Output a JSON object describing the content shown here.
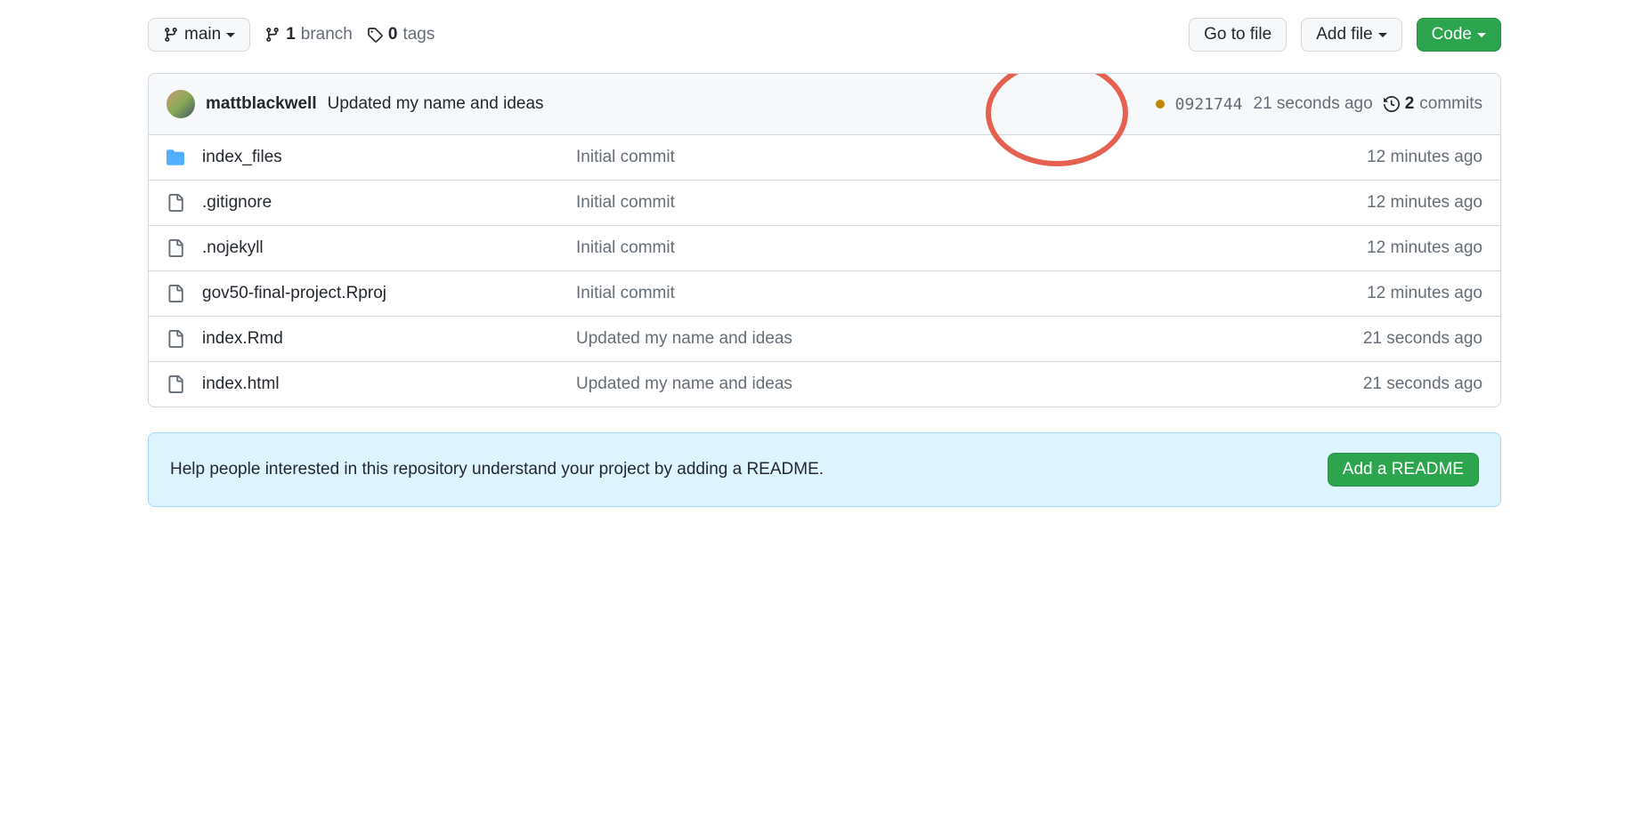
{
  "toolbar": {
    "branch_name": "main",
    "branch_count": "1",
    "branch_label": "branch",
    "tag_count": "0",
    "tag_label": "tags",
    "go_to_file": "Go to file",
    "add_file": "Add file",
    "code": "Code"
  },
  "latest_commit": {
    "author": "mattblackwell",
    "message": "Updated my name and ideas",
    "sha": "0921744",
    "time": "21 seconds ago",
    "commit_count": "2",
    "commit_label": "commits"
  },
  "files": [
    {
      "type": "dir",
      "name": "index_files",
      "message": "Initial commit",
      "time": "12 minutes ago"
    },
    {
      "type": "file",
      "name": ".gitignore",
      "message": "Initial commit",
      "time": "12 minutes ago"
    },
    {
      "type": "file",
      "name": ".nojekyll",
      "message": "Initial commit",
      "time": "12 minutes ago"
    },
    {
      "type": "file",
      "name": "gov50-final-project.Rproj",
      "message": "Initial commit",
      "time": "12 minutes ago"
    },
    {
      "type": "file",
      "name": "index.Rmd",
      "message": "Updated my name and ideas",
      "time": "21 seconds ago"
    },
    {
      "type": "file",
      "name": "index.html",
      "message": "Updated my name and ideas",
      "time": "21 seconds ago"
    }
  ],
  "readme_banner": {
    "text": "Help people interested in this repository understand your project by adding a README.",
    "button": "Add a README"
  }
}
